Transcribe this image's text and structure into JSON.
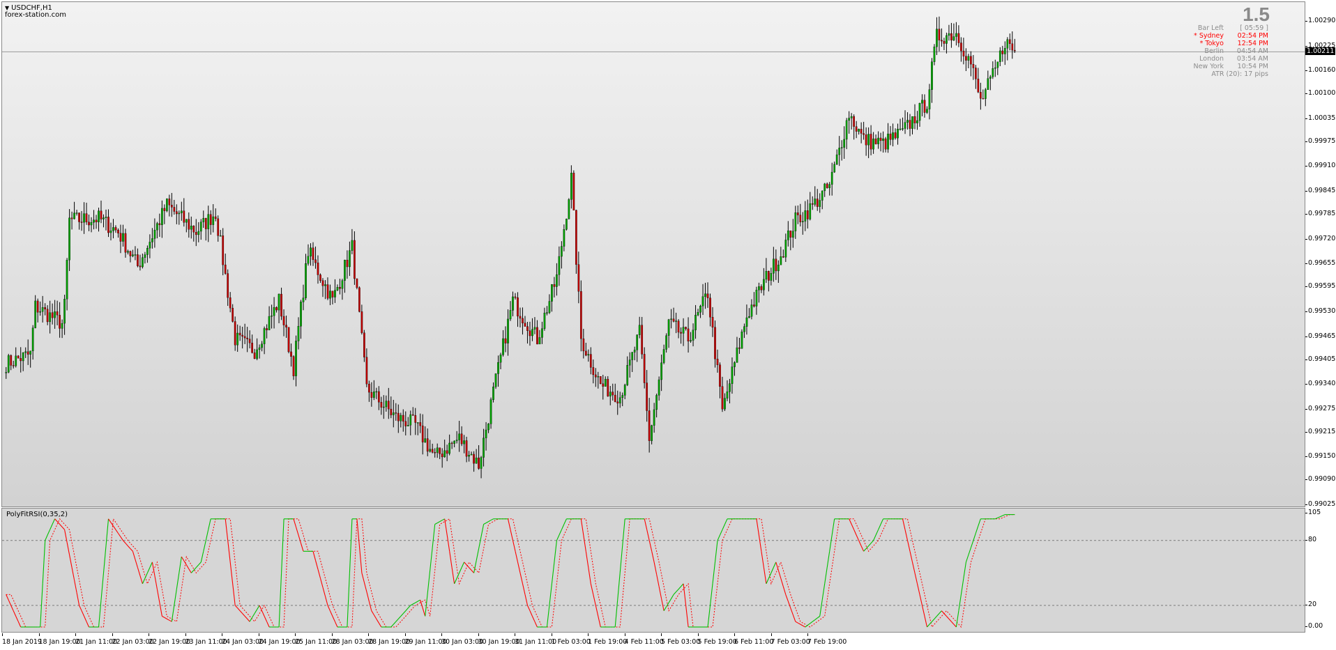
{
  "window": {
    "symbol": "USDCHF,H1",
    "provider": "forex-station.com",
    "spread": "1.5"
  },
  "info_panel": [
    {
      "label": "Bar Left",
      "value": "[ 05:59 ]",
      "color": "#8c8c8c"
    },
    {
      "label": "* Sydney",
      "value": "02:54 PM",
      "color": "#ff0000"
    },
    {
      "label": "* Tokyo",
      "value": "12:54 PM",
      "color": "#ff0000"
    },
    {
      "label": "Berlin",
      "value": "04:54 AM",
      "color": "#8c8c8c"
    },
    {
      "label": "London",
      "value": "03:54 AM",
      "color": "#8c8c8c"
    },
    {
      "label": "New York",
      "value": "10:54 PM",
      "color": "#8c8c8c"
    },
    {
      "label": "ATR (20): 17 pips",
      "value": "",
      "color": "#8c8c8c"
    }
  ],
  "indicator": {
    "label": "PolyFitRSI(0,35,2)"
  },
  "colors": {
    "bull": "#00a000",
    "bear": "#c00000",
    "wick": "#000000",
    "ind_up": "#00c000",
    "ind_down": "#ff0000",
    "ind_signal": "#ff0000"
  },
  "chart_data": [
    {
      "type": "candlestick",
      "symbol": "USDCHF",
      "timeframe": "H1",
      "ylim": [
        0.99025,
        1.0029
      ],
      "y_ticks": [
        "1.00290",
        "1.00225",
        "1.00160",
        "1.00100",
        "1.00035",
        "0.99975",
        "0.99910",
        "0.99845",
        "0.99785",
        "0.99720",
        "0.99655",
        "0.99595",
        "0.99530",
        "0.99465",
        "0.99405",
        "0.99340",
        "0.99275",
        "0.99215",
        "0.99150",
        "0.99090",
        "0.99025"
      ],
      "current_price": "1.00211",
      "x_ticks": [
        "18 Jan 2019",
        "18 Jan 19:00",
        "21 Jan 11:00",
        "22 Jan 03:00",
        "22 Jan 19:00",
        "23 Jan 11:00",
        "24 Jan 03:00",
        "24 Jan 19:00",
        "25 Jan 11:00",
        "28 Jan 03:00",
        "28 Jan 19:00",
        "29 Jan 11:00",
        "30 Jan 03:00",
        "30 Jan 19:00",
        "31 Jan 11:00",
        "1 Feb 03:00",
        "1 Feb 19:00",
        "4 Feb 11:00",
        "5 Feb 03:00",
        "5 Feb 19:00",
        "6 Feb 11:00",
        "7 Feb 03:00",
        "7 Feb 19:00"
      ],
      "close_path": [
        [
          0,
          0.99395
        ],
        [
          10,
          0.9942
        ],
        [
          12,
          0.99545
        ],
        [
          23,
          0.995
        ],
        [
          24,
          0.99545
        ],
        [
          26,
          0.9977
        ],
        [
          38,
          0.99775
        ],
        [
          46,
          0.9974
        ],
        [
          54,
          0.9965
        ],
        [
          66,
          0.9981
        ],
        [
          78,
          0.9974
        ],
        [
          86,
          0.9979
        ],
        [
          94,
          0.9946
        ],
        [
          102,
          0.9943
        ],
        [
          112,
          0.9956
        ],
        [
          118,
          0.99385
        ],
        [
          124,
          0.9969
        ],
        [
          134,
          0.9956
        ],
        [
          142,
          0.997
        ],
        [
          148,
          0.9933
        ],
        [
          160,
          0.99255
        ],
        [
          168,
          0.99235
        ],
        [
          176,
          0.9915
        ],
        [
          186,
          0.992
        ],
        [
          194,
          0.9913
        ],
        [
          200,
          0.9932
        ],
        [
          208,
          0.9956
        ],
        [
          218,
          0.9946
        ],
        [
          226,
          0.9962
        ],
        [
          232,
          0.9988
        ],
        [
          236,
          0.9946
        ],
        [
          244,
          0.9934
        ],
        [
          252,
          0.9931
        ],
        [
          260,
          0.99475
        ],
        [
          264,
          0.992
        ],
        [
          272,
          0.995
        ],
        [
          280,
          0.9946
        ],
        [
          288,
          0.9958
        ],
        [
          294,
          0.9927
        ],
        [
          304,
          0.9952
        ],
        [
          312,
          0.9962
        ],
        [
          318,
          0.9968
        ],
        [
          324,
          0.9977
        ],
        [
          330,
          0.998
        ],
        [
          338,
          0.9986
        ],
        [
          346,
          1.0005
        ],
        [
          352,
          0.9998
        ],
        [
          360,
          0.9997
        ],
        [
          368,
          1.0
        ],
        [
          378,
          1.0008
        ],
        [
          382,
          1.0025
        ],
        [
          390,
          1.0026
        ],
        [
          396,
          1.0018
        ],
        [
          400,
          1.0008
        ],
        [
          406,
          1.0016
        ],
        [
          410,
          1.0024
        ],
        [
          414,
          1.00211
        ]
      ]
    },
    {
      "type": "line",
      "title": "PolyFitRSI(0,35,2)",
      "ylim": [
        0,
        105
      ],
      "y_ticks": [
        "105",
        "80",
        "20",
        "0.00"
      ],
      "levels": [
        80,
        20
      ],
      "series": [
        {
          "name": "",
          "color_up": "#00c000",
          "color_down": "#ff0000",
          "values": [
            [
              0,
              30
            ],
            [
              6,
              0
            ],
            [
              14,
              0
            ],
            [
              16,
              80
            ],
            [
              20,
              100
            ],
            [
              24,
              90
            ],
            [
              30,
              20
            ],
            [
              34,
              0
            ],
            [
              38,
              0
            ],
            [
              42,
              100
            ],
            [
              48,
              80
            ],
            [
              52,
              70
            ],
            [
              56,
              40
            ],
            [
              60,
              60
            ],
            [
              64,
              10
            ],
            [
              68,
              5
            ],
            [
              72,
              65
            ],
            [
              76,
              50
            ],
            [
              80,
              60
            ],
            [
              84,
              100
            ],
            [
              90,
              100
            ],
            [
              94,
              20
            ],
            [
              100,
              5
            ],
            [
              104,
              20
            ],
            [
              108,
              0
            ],
            [
              112,
              0
            ],
            [
              114,
              100
            ],
            [
              118,
              100
            ],
            [
              122,
              70
            ],
            [
              126,
              70
            ],
            [
              132,
              20
            ],
            [
              136,
              0
            ],
            [
              140,
              0
            ],
            [
              142,
              100
            ],
            [
              144,
              100
            ],
            [
              146,
              50
            ],
            [
              150,
              15
            ],
            [
              154,
              0
            ],
            [
              158,
              0
            ],
            [
              162,
              10
            ],
            [
              166,
              20
            ],
            [
              170,
              25
            ],
            [
              172,
              10
            ],
            [
              176,
              95
            ],
            [
              180,
              100
            ],
            [
              184,
              40
            ],
            [
              188,
              60
            ],
            [
              192,
              50
            ],
            [
              196,
              95
            ],
            [
              200,
              100
            ],
            [
              206,
              100
            ],
            [
              210,
              60
            ],
            [
              214,
              20
            ],
            [
              218,
              0
            ],
            [
              222,
              0
            ],
            [
              226,
              80
            ],
            [
              230,
              100
            ],
            [
              236,
              100
            ],
            [
              240,
              40
            ],
            [
              244,
              0
            ],
            [
              250,
              0
            ],
            [
              254,
              100
            ],
            [
              262,
              100
            ],
            [
              266,
              60
            ],
            [
              270,
              15
            ],
            [
              274,
              30
            ],
            [
              278,
              40
            ],
            [
              280,
              0
            ],
            [
              288,
              0
            ],
            [
              292,
              80
            ],
            [
              296,
              100
            ],
            [
              308,
              100
            ],
            [
              312,
              40
            ],
            [
              316,
              60
            ],
            [
              320,
              30
            ],
            [
              324,
              5
            ],
            [
              328,
              0
            ],
            [
              334,
              10
            ],
            [
              340,
              100
            ],
            [
              346,
              100
            ],
            [
              352,
              70
            ],
            [
              356,
              80
            ],
            [
              360,
              100
            ],
            [
              368,
              100
            ],
            [
              374,
              40
            ],
            [
              378,
              0
            ],
            [
              384,
              15
            ],
            [
              390,
              0
            ],
            [
              394,
              60
            ],
            [
              400,
              100
            ],
            [
              406,
              100
            ],
            [
              410,
              104
            ]
          ]
        }
      ]
    }
  ]
}
